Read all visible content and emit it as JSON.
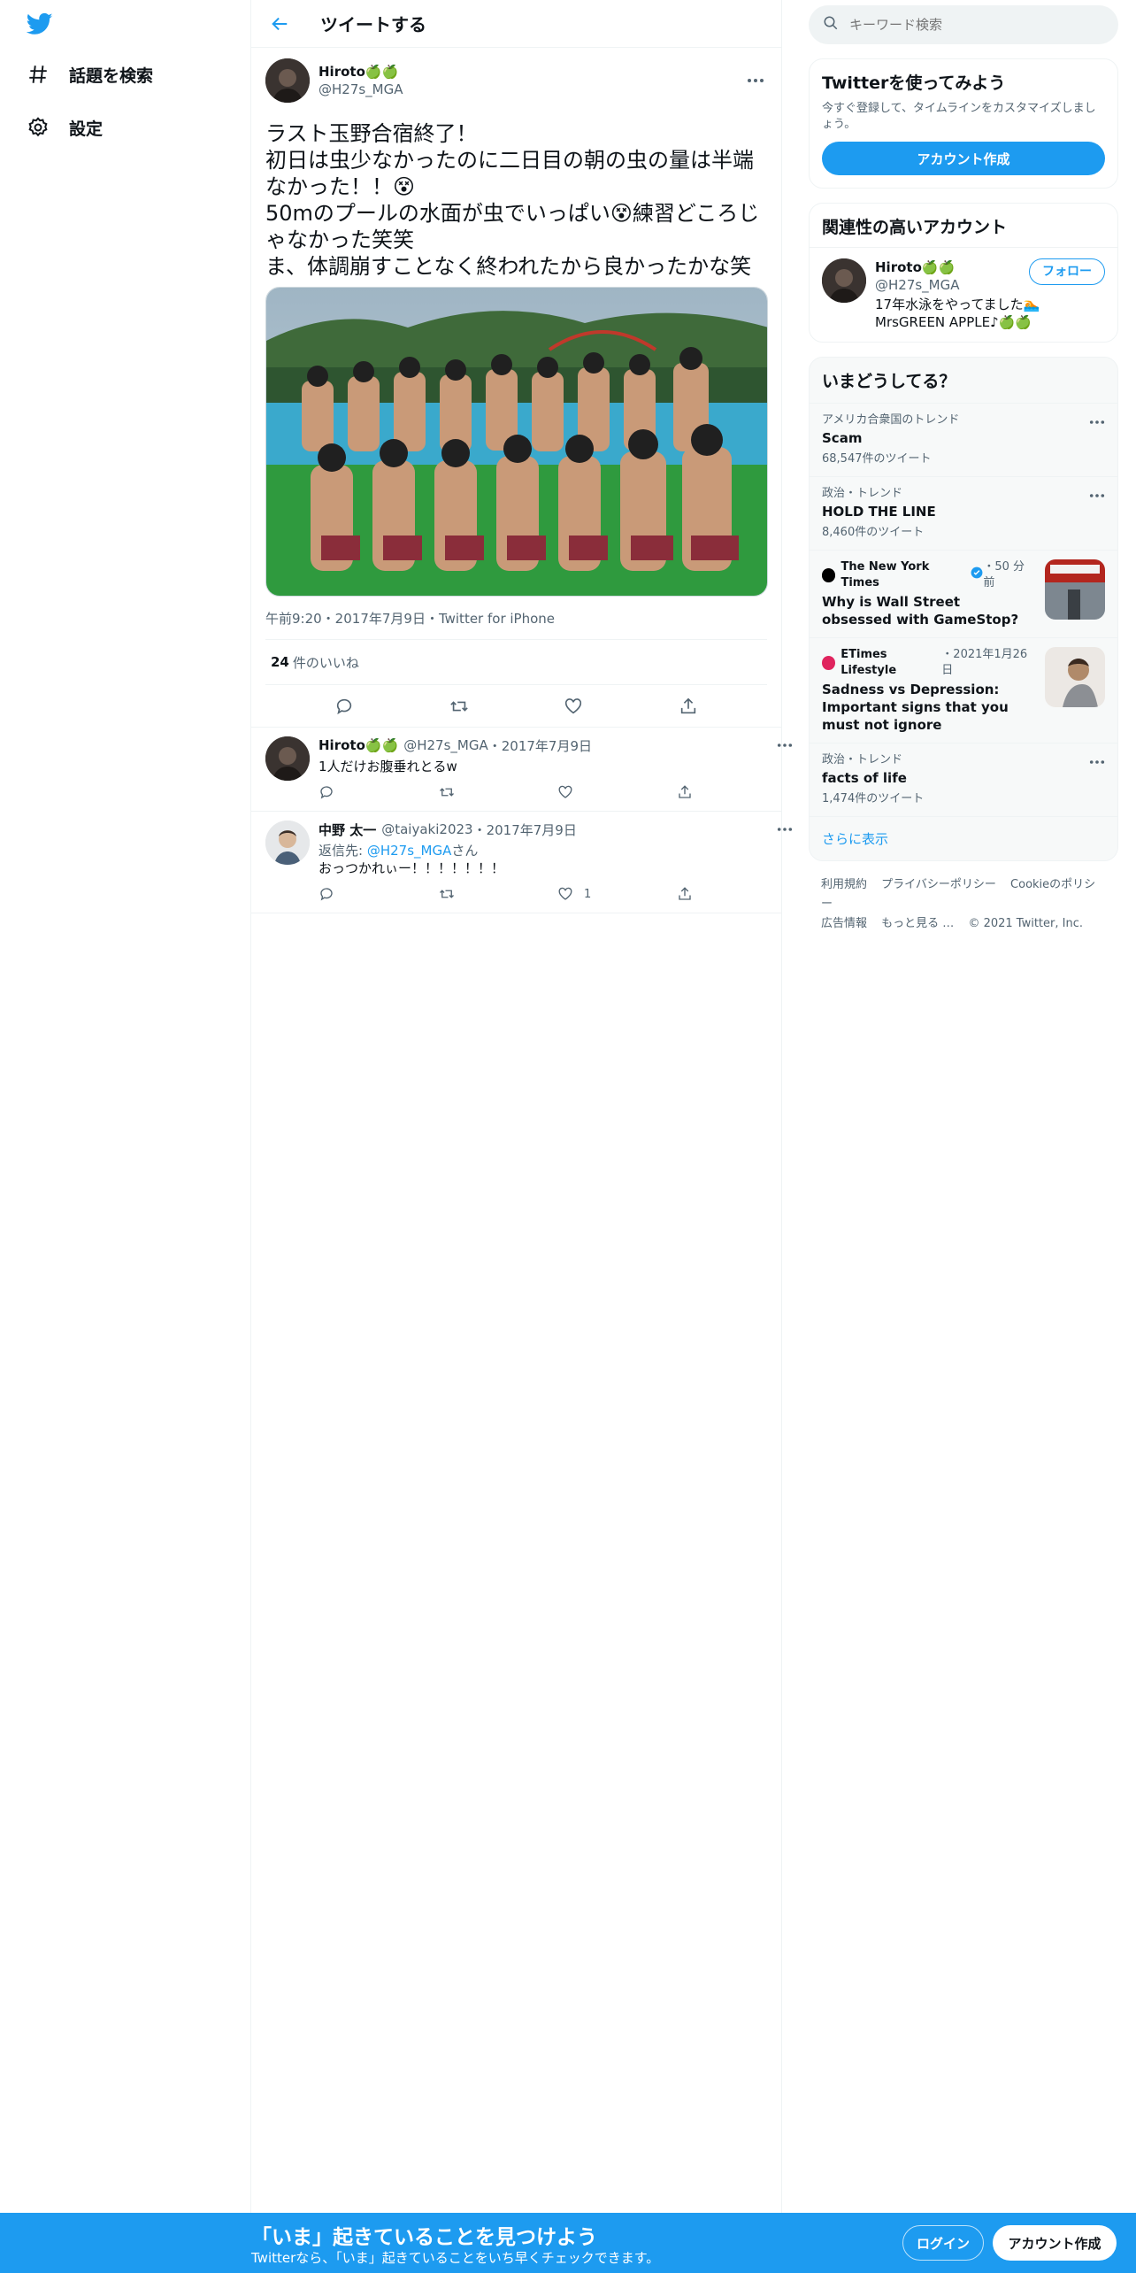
{
  "nav": {
    "items": [
      {
        "label": "話題を検索",
        "icon": "hashtag-icon"
      },
      {
        "label": "設定",
        "icon": "gear-icon"
      }
    ]
  },
  "header": {
    "title": "ツイートする"
  },
  "tweet": {
    "author_name": "Hiroto🍏🍏",
    "author_handle": "@H27s_MGA",
    "text": "ラスト玉野合宿終了！\n初日は虫少なかったのに二日目の朝の虫の量は半端なかった！！😵\n50mのプールの水面が虫でいっぱい😵練習どころじゃなかった笑笑\nま、体調崩すことなく終われたから良かったかな笑",
    "meta": "午前9:20・2017年7月9日・Twitter for iPhone",
    "likes_count": "24",
    "likes_label": "件のいいね"
  },
  "replies": [
    {
      "author_name": "Hiroto🍏🍏",
      "author_handle": "@H27s_MGA",
      "date": "・2017年7月9日",
      "reply_to_prefix": "",
      "reply_to_handle": "",
      "reply_to_suffix": "",
      "text": "1人だけお腹垂れとるw",
      "like_count": ""
    },
    {
      "author_name": "中野 太一",
      "author_handle": "@taiyaki2023",
      "date": "・2017年7月9日",
      "reply_to_prefix": "返信先: ",
      "reply_to_handle": "@H27s_MGA",
      "reply_to_suffix": "さん",
      "text": "おっつかれぃー！！！！！！！",
      "like_count": "1"
    }
  ],
  "search": {
    "placeholder": "キーワード検索"
  },
  "signup_card": {
    "title": "Twitterを使ってみよう",
    "desc": "今すぐ登録して、タイムラインをカスタマイズしましょう。",
    "button": "アカウント作成"
  },
  "related": {
    "title": "関連性の高いアカウント",
    "name": "Hiroto🍏🍏",
    "handle": "@H27s_MGA",
    "follow": "フォロー",
    "bio": "17年水泳をやってました🏊\nMrsGREEN APPLE♪🍏🍏"
  },
  "trends": {
    "title": "いまどうしてる？",
    "items": [
      {
        "category": "アメリカ合衆国のトレンド",
        "name": "Scam",
        "count": "68,547件のツイート"
      },
      {
        "category": "政治・トレンド",
        "name": "HOLD THE LINE",
        "count": "8,460件のツイート"
      }
    ],
    "news": [
      {
        "source": "The New York Times",
        "time": "・50 分前",
        "title": "Why is Wall Street obsessed with GameStop?",
        "logo_color": "#000000"
      },
      {
        "source": "ETimes Lifestyle",
        "time": "・2021年1月26日",
        "title": "Sadness vs Depression: Important signs that you must not ignore",
        "logo_color": "#e0245e"
      }
    ],
    "last": {
      "category": "政治・トレンド",
      "name": "facts of life",
      "count": "1,474件のツイート"
    },
    "show_more": "さらに表示"
  },
  "footer": {
    "links": [
      "利用規約",
      "プライバシーポリシー",
      "Cookieのポリシー",
      "広告情報",
      "もっと見る …",
      "© 2021 Twitter, Inc."
    ]
  },
  "bottom_bar": {
    "title": "「いま」起きていることを見つけよう",
    "sub": "Twitterなら、「いま」起きていることをいち早くチェックできます。",
    "login": "ログイン",
    "signup": "アカウント作成"
  },
  "colors": {
    "accent": "#1d9bf0",
    "text": "#0f1419",
    "muted": "#536471"
  }
}
